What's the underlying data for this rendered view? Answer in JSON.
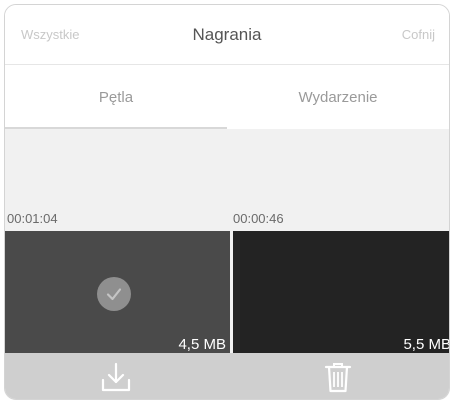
{
  "header": {
    "select_all_label": "Wszystkie",
    "title": "Nagrania",
    "undo_label": "Cofnij"
  },
  "tabs": [
    {
      "label": "Pętla",
      "active": true
    },
    {
      "label": "Wydarzenie",
      "active": false
    }
  ],
  "clips": [
    {
      "time": "00:01:04",
      "size": "4,5 MB",
      "selected": true
    },
    {
      "time": "00:00:46",
      "size": "5,5 MB",
      "selected": false
    }
  ],
  "toolbar": {
    "icons": [
      "download-icon",
      "trash-icon"
    ]
  },
  "colors": {
    "toolbar_bg": "#cfcfcf",
    "list_bg": "#f1f1f1",
    "check_bg": "#8f8f8f"
  }
}
